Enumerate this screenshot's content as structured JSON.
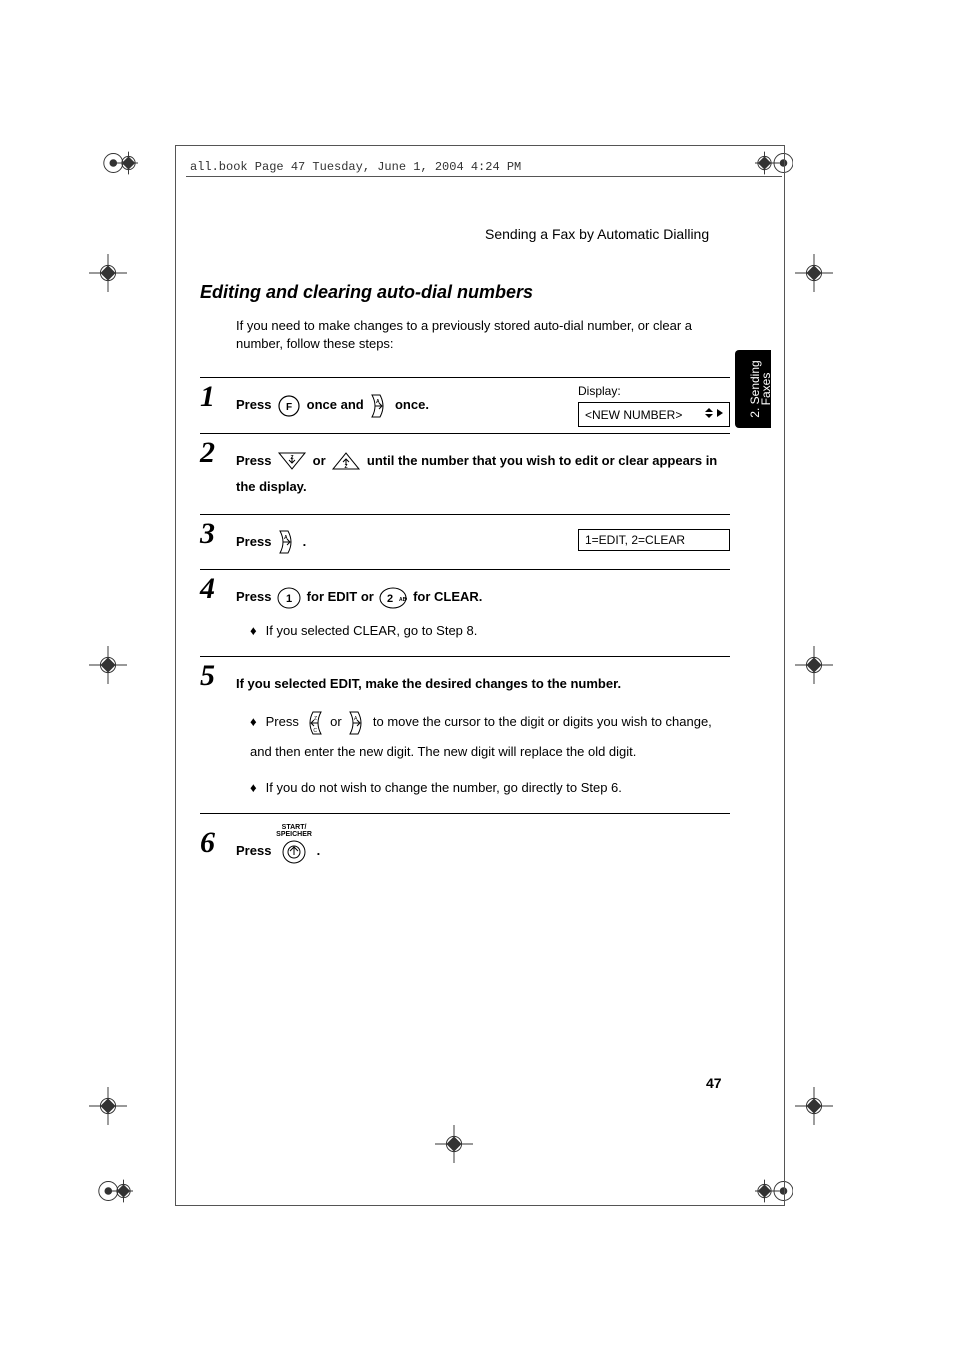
{
  "header_stamp": "all.book  Page 47  Tuesday, June 1, 2004  4:24 PM",
  "running_head": "Sending a Fax by Automatic Dialling",
  "side_tab": {
    "line1": "2. Sending",
    "line2": "Faxes"
  },
  "section_title": "Editing and clearing auto-dial numbers",
  "intro": "If you need to make changes to a previously stored auto-dial number, or clear a number, follow these steps:",
  "display_label": "Display:",
  "lcd1": "<NEW NUMBER>",
  "lcd2": "1=EDIT, 2=CLEAR",
  "steps": {
    "s1": {
      "num": "1",
      "a": "Press ",
      "b": " once and ",
      "c": " once."
    },
    "s2": {
      "num": "2",
      "a": "Press ",
      "b": " or ",
      "c": " until the number that you wish to edit or clear appears in the display."
    },
    "s3": {
      "num": "3",
      "a": "Press ",
      "b": " ."
    },
    "s4": {
      "num": "4",
      "a": "Press ",
      "b": " for EDIT or ",
      "c": " for CLEAR.",
      "sub1": "If you selected CLEAR, go to Step 8."
    },
    "s5": {
      "num": "5",
      "main": "If you selected EDIT, make the desired changes to the number.",
      "sub1a": "Press ",
      "sub1b": " or ",
      "sub1c": " to move the cursor to the digit or digits you wish to change, and then enter the new digit. The new digit will replace the old digit.",
      "sub2": "If you do not wish to change the number, go directly to Step 6."
    },
    "s6": {
      "num": "6",
      "a": "Press ",
      "b": " .",
      "start_top": "START/",
      "start_bot": "SPEICHER"
    }
  },
  "page_number": "47"
}
